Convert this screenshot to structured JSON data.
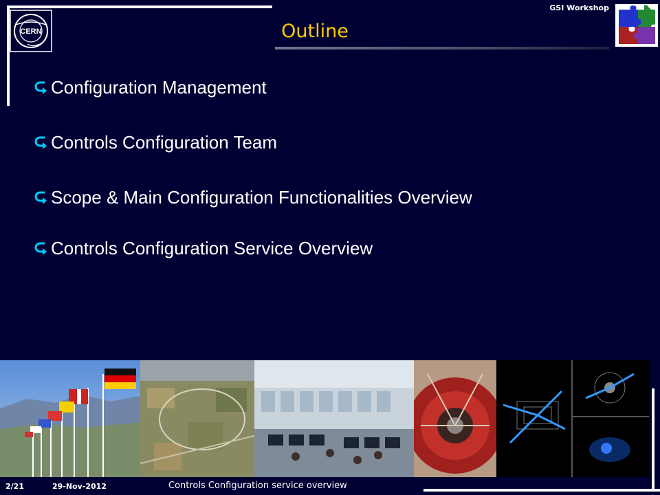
{
  "header": {
    "event_label": "GSI Workshop",
    "title": "Outline",
    "logo_text": "CERN"
  },
  "bullets": [
    "Configuration Management",
    "Controls Configuration Team",
    "Scope & Main Configuration Functionalities Overview",
    "Controls Configuration Service Overview"
  ],
  "footer": {
    "page": "2/21",
    "date": "29-Nov-2012",
    "presentation_title": "Controls Configuration service overview"
  },
  "photos": [
    {
      "icon": "flags-photo"
    },
    {
      "icon": "aerial-view-photo"
    },
    {
      "icon": "control-room-photo"
    },
    {
      "icon": "detector-photo"
    },
    {
      "icon": "event-display-photo"
    }
  ],
  "colors": {
    "background": "#000033",
    "title": "#ffcc00",
    "text": "#ffffff",
    "bullet_arrow": "#00ccff"
  }
}
